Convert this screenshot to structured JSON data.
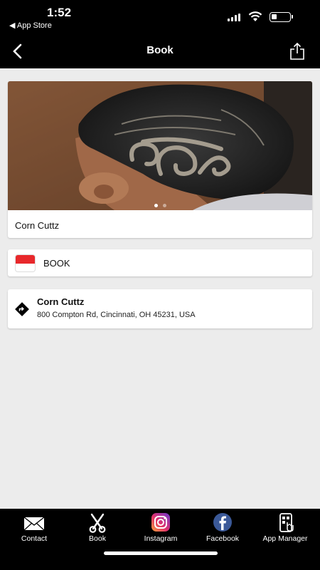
{
  "status": {
    "time": "1:52",
    "back_app": "◀ App Store",
    "battery_level": 0.28
  },
  "nav": {
    "title": "Book"
  },
  "gallery": {
    "caption": "Corn Cuttz",
    "page_count": 2,
    "active_page": 1
  },
  "book": {
    "label": "BOOK"
  },
  "location": {
    "name": "Corn Cuttz",
    "address": "800 Compton Rd, Cincinnati, OH 45231, USA"
  },
  "tabs": [
    {
      "label": "Contact",
      "icon": "envelope-icon"
    },
    {
      "label": "Book",
      "icon": "scissors-icon"
    },
    {
      "label": "Instagram",
      "icon": "instagram-icon"
    },
    {
      "label": "Facebook",
      "icon": "facebook-icon"
    },
    {
      "label": "App Manager",
      "icon": "app-manager-icon"
    }
  ],
  "colors": {
    "bar_bg": "#000000",
    "page_bg": "#ececec",
    "calendar_red": "#e8282b",
    "facebook_blue": "#3b5998"
  }
}
